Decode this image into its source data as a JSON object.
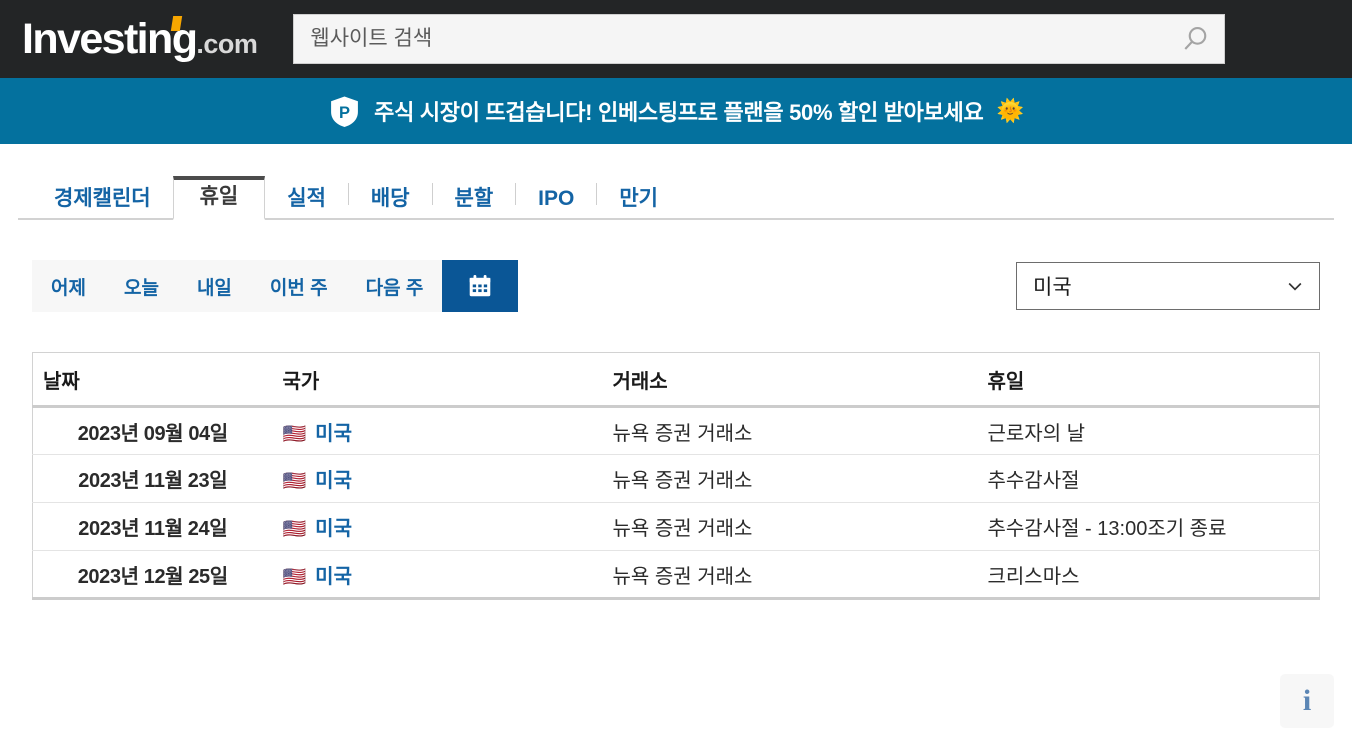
{
  "header": {
    "logo_main": "Investing",
    "logo_suffix": ".com",
    "accent_color": "#f7a600",
    "background_color": "#232526",
    "search": {
      "placeholder": "웹사이트 검색",
      "value": "",
      "icon": "search-icon"
    }
  },
  "banner": {
    "icon": "investingpro-shield-icon",
    "text": "주식 시장이 뜨겁습니다! 인베스팅프로 플랜을 50% 할인 받아보세요",
    "emoji": "🌞",
    "background_color": "#04719E"
  },
  "tabs": [
    {
      "label": "경제캘린더",
      "active": false
    },
    {
      "label": "휴일",
      "active": true
    },
    {
      "label": "실적",
      "active": false
    },
    {
      "label": "배당",
      "active": false
    },
    {
      "label": "분할",
      "active": false
    },
    {
      "label": "IPO",
      "active": false
    },
    {
      "label": "만기",
      "active": false
    }
  ],
  "quick_filters": [
    {
      "label": "어제",
      "active": false
    },
    {
      "label": "오늘",
      "active": false
    },
    {
      "label": "내일",
      "active": false
    },
    {
      "label": "이번 주",
      "active": false
    },
    {
      "label": "다음 주",
      "active": false
    }
  ],
  "calendar_button": {
    "icon": "calendar-icon",
    "active": true,
    "color": "#0a5696"
  },
  "country_filter": {
    "selected": "미국",
    "icon": "chevron-down-icon"
  },
  "table": {
    "columns": [
      "날짜",
      "국가",
      "거래소",
      "휴일"
    ],
    "rows": [
      {
        "date": "2023년 09월 04일",
        "country": "미국",
        "flag": "🇺🇸",
        "exchange": "뉴욕 증권 거래소",
        "holiday": "근로자의 날"
      },
      {
        "date": "2023년 11월 23일",
        "country": "미국",
        "flag": "🇺🇸",
        "exchange": "뉴욕 증권 거래소",
        "holiday": "추수감사절"
      },
      {
        "date": "2023년 11월 24일",
        "country": "미국",
        "flag": "🇺🇸",
        "exchange": "뉴욕 증권 거래소",
        "holiday": "추수감사절 - 13:00조기 종료"
      },
      {
        "date": "2023년 12월 25일",
        "country": "미국",
        "flag": "🇺🇸",
        "exchange": "뉴욕 증권 거래소",
        "holiday": "크리스마스"
      }
    ]
  },
  "info_button": {
    "label": "i",
    "icon": "info-icon"
  }
}
